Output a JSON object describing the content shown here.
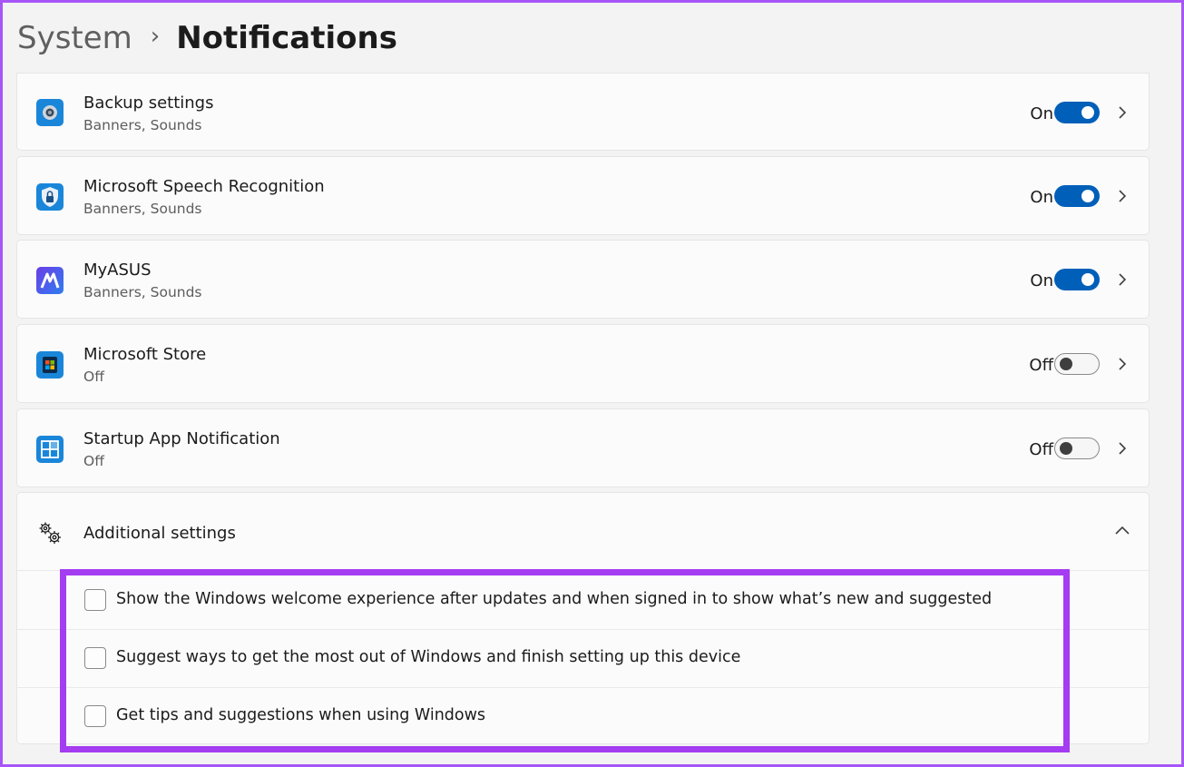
{
  "breadcrumb": {
    "parent": "System",
    "separator": "›",
    "current": "Notifications"
  },
  "apps": [
    {
      "name": "Backup settings",
      "sub": "Banners, Sounds",
      "state": "On",
      "icon": "backup-settings-icon"
    },
    {
      "name": "Microsoft Speech Recognition",
      "sub": "Banners, Sounds",
      "state": "On",
      "icon": "speech-recognition-icon"
    },
    {
      "name": "MyASUS",
      "sub": "Banners, Sounds",
      "state": "On",
      "icon": "myasus-icon"
    },
    {
      "name": "Microsoft Store",
      "sub": "Off",
      "state": "Off",
      "icon": "microsoft-store-icon"
    },
    {
      "name": "Startup App Notification",
      "sub": "Off",
      "state": "Off",
      "icon": "startup-app-icon"
    }
  ],
  "additional": {
    "title": "Additional settings",
    "options": [
      {
        "label": "Show the Windows welcome experience after updates and when signed in to show what’s new and suggested",
        "checked": false
      },
      {
        "label": "Suggest ways to get the most out of Windows and finish setting up this device",
        "checked": false
      },
      {
        "label": "Get tips and suggestions when using Windows",
        "checked": false
      }
    ]
  },
  "colors": {
    "accent": "#005fb8",
    "highlight": "#a43cf2",
    "frame": "#a855f7"
  }
}
